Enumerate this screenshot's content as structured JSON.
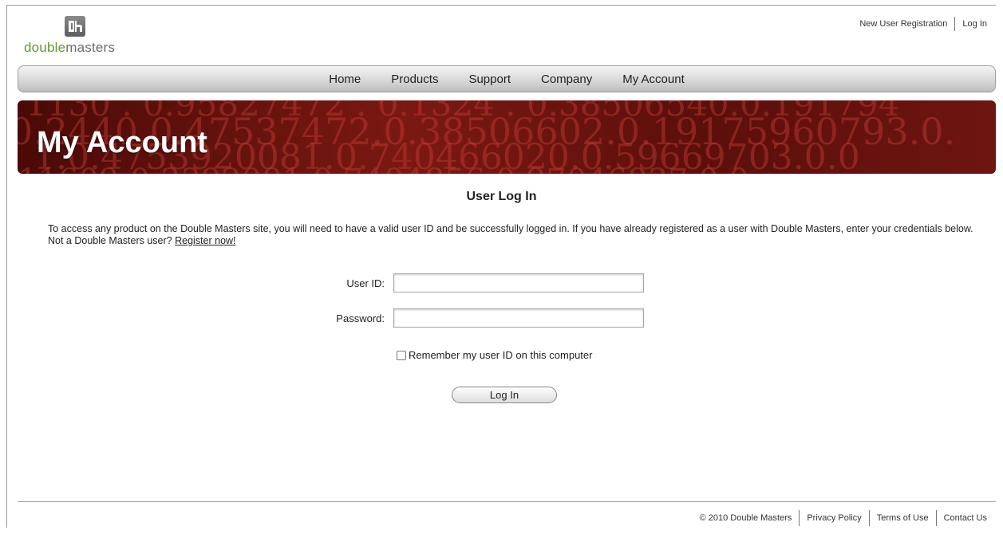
{
  "brand": {
    "logo_part1": "double",
    "logo_part2": "masters",
    "logo_icon": "dm-monogram-icon",
    "colors": {
      "logo_green": "#5f9a2b",
      "banner_red": "#7a1912"
    }
  },
  "top_links": {
    "new_user": "New User Registration",
    "login": "Log In"
  },
  "nav": {
    "items": [
      {
        "label": "Home"
      },
      {
        "label": "Products"
      },
      {
        "label": "Support"
      },
      {
        "label": "Company"
      },
      {
        "label": "My Account"
      }
    ]
  },
  "banner": {
    "title": "My Account"
  },
  "login": {
    "heading": "User Log In",
    "intro": "To access any product on the Double Masters site, you will need to have a valid user ID and be successfully logged in. If you have already registered as a user with Double Masters, enter your credentials below. Not a Double Masters user? ",
    "register_link": "Register now!",
    "user_id_label": "User ID:",
    "user_id_value": "",
    "password_label": "Password:",
    "password_value": "",
    "remember_label": "Remember my user ID on this computer",
    "remember_checked": false,
    "button": "Log In"
  },
  "footer": {
    "copyright": "© 2010 Double Masters",
    "privacy": "Privacy Policy",
    "terms": "Terms of Use",
    "contact": "Contact Us"
  }
}
